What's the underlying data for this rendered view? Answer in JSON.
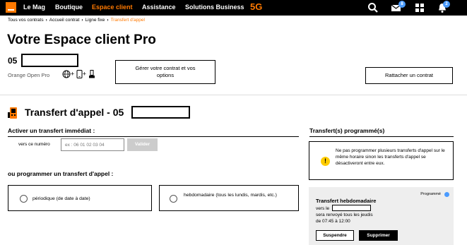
{
  "nav": {
    "items": [
      "Le Mag",
      "Boutique",
      "Espace client",
      "Assistance",
      "Solutions Business"
    ],
    "five_g": "5G",
    "icons": [
      "search-icon",
      "mail-icon",
      "apps-grid-icon",
      "bell-icon"
    ],
    "mail_badge": "8",
    "bell_badge": "2"
  },
  "breadcrumb": {
    "items": [
      "Tous vos contrats",
      "Accueil contrat",
      "Ligne fixe"
    ],
    "current": "Transfert d'appel"
  },
  "page": {
    "title": "Votre Espace client Pro",
    "contract_prefix": "05",
    "offer_name": "Orange Open Pro",
    "services_plus_1": "+",
    "services_plus_2": "+",
    "manage_button": "Gérer votre contrat et vos options",
    "attach_button": "Rattacher un contrat"
  },
  "transfer": {
    "title": "Transfert d'appel - 05",
    "immediate_title": "Activer un transfert immédiat :",
    "to_number_label": "vers ce numéro",
    "phone_placeholder": "ex : 06 01 02 03 04",
    "validate_button": "Valider",
    "program_title": "ou programmer un transfert d'appel :",
    "option_periodic": "périodique (de date à date)",
    "option_weekly": "hebdomadaire (tous les lundis, mardis, etc.)"
  },
  "scheduled": {
    "title": "Transfert(s) programmé(s)",
    "info_text": "Ne pas programmer plusieurs transferts d'appel sur le même horaire sinon les transferts d'appel se désactiveront entre eux.",
    "card": {
      "status": "Programmé",
      "title": "Transfert hebdomadaire",
      "to_label": "vers le",
      "repeat": "sera renvoyé tous les jeudis",
      "time": "de 07:45 à 12:00",
      "suspend_button": "Suspendre",
      "delete_button": "Supprimer"
    }
  },
  "colors": {
    "accent": "#ff7900",
    "nav_bg": "#000000",
    "badge": "#4a9bff",
    "warning": "#ffcc00"
  }
}
